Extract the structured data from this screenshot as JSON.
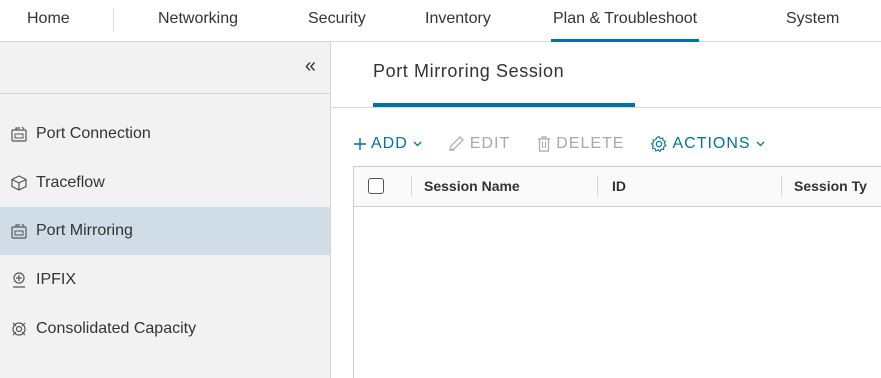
{
  "topnav": {
    "tabs": [
      {
        "label": "Home"
      },
      {
        "label": "Networking"
      },
      {
        "label": "Security"
      },
      {
        "label": "Inventory"
      },
      {
        "label": "Plan & Troubleshoot",
        "active": true
      },
      {
        "label": "System"
      }
    ]
  },
  "sidebar": {
    "collapse_label": "«",
    "items": [
      {
        "label": "Port Connection",
        "icon": "port-connection-icon"
      },
      {
        "label": "Traceflow",
        "icon": "cube-icon"
      },
      {
        "label": "Port Mirroring",
        "icon": "port-mirroring-icon",
        "active": true
      },
      {
        "label": "IPFIX",
        "icon": "ipfix-icon"
      },
      {
        "label": "Consolidated Capacity",
        "icon": "capacity-icon"
      }
    ]
  },
  "main": {
    "page_tab": "Port Mirroring Session",
    "toolbar": {
      "add_label": "ADD",
      "edit_label": "EDIT",
      "delete_label": "DELETE",
      "actions_label": "ACTIONS"
    },
    "grid": {
      "columns": [
        "Session Name",
        "ID",
        "Session Ty"
      ]
    }
  },
  "colors": {
    "accent": "#0072a3",
    "sidebar_bg": "#f2f2f2",
    "sidebar_active": "#d0dde6",
    "disabled": "#a8a8a8"
  }
}
